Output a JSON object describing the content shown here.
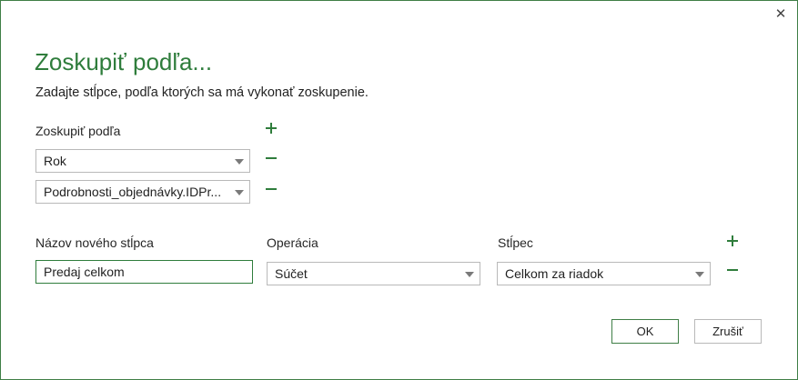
{
  "dialog": {
    "title": "Zoskupiť podľa...",
    "description": "Zadajte stĺpce, podľa ktorých sa má vykonať zoskupenie.",
    "close_icon": "close-icon"
  },
  "group_by": {
    "label": "Zoskupiť podľa",
    "fields": [
      {
        "selected": "Rok"
      },
      {
        "selected": "Podrobnosti_objednávky.IDPr..."
      }
    ]
  },
  "aggregation": {
    "new_column_label": "Názov nového stĺpca",
    "operation_label": "Operácia",
    "column_label": "Stĺpec",
    "new_column_value": "Predaj celkom",
    "operation_selected": "Súčet",
    "column_selected": "Celkom za riadok"
  },
  "buttons": {
    "ok": "OK",
    "cancel": "Zrušiť"
  },
  "colors": {
    "accent": "#2f7d3c",
    "border": "#3f7e46"
  }
}
